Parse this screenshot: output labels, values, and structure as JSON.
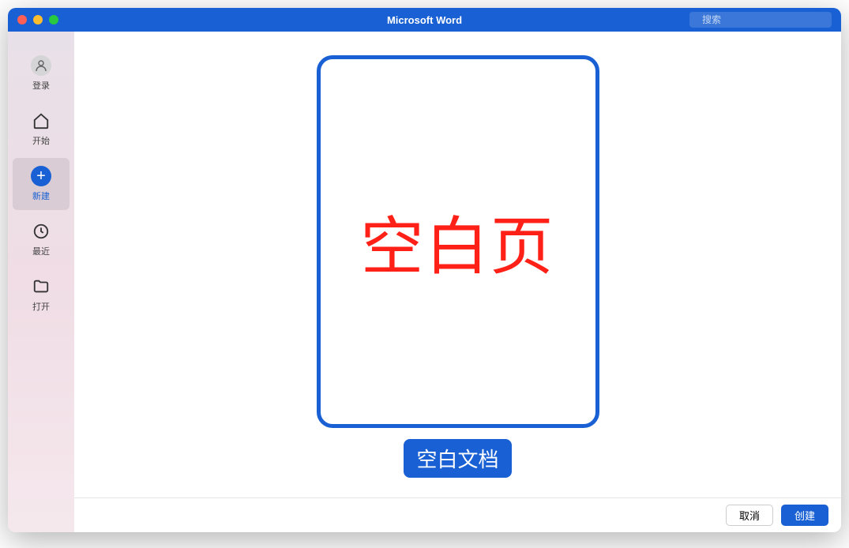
{
  "titlebar": {
    "title": "Microsoft Word",
    "search_placeholder": "搜索"
  },
  "sidebar": {
    "items": [
      {
        "label": "登录",
        "icon": "user"
      },
      {
        "label": "开始",
        "icon": "home"
      },
      {
        "label": "新建",
        "icon": "plus",
        "active": true
      },
      {
        "label": "最近",
        "icon": "clock"
      },
      {
        "label": "打开",
        "icon": "folder"
      }
    ]
  },
  "template": {
    "preview_text": "空白页",
    "label": "空白文档"
  },
  "buttons": {
    "cancel": "取消",
    "create": "创建"
  }
}
